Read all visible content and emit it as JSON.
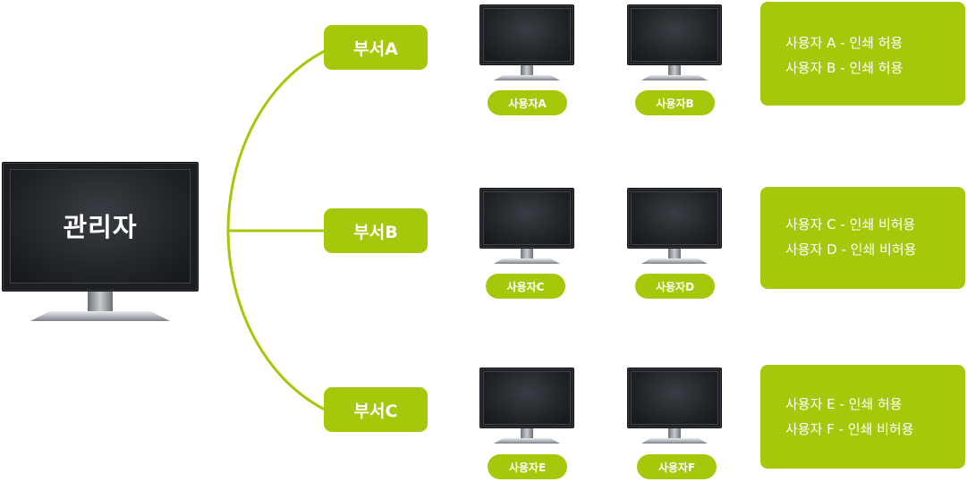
{
  "colors": {
    "accent": "#a6c80a",
    "line": "#a6c80a",
    "screen": "#23262a"
  },
  "admin": {
    "label": "관리자"
  },
  "departments": [
    {
      "label": "부서A"
    },
    {
      "label": "부서B"
    },
    {
      "label": "부서C"
    }
  ],
  "users": [
    {
      "label": "사용자A"
    },
    {
      "label": "사용자B"
    },
    {
      "label": "사용자C"
    },
    {
      "label": "사용자D"
    },
    {
      "label": "사용자E"
    },
    {
      "label": "사용자F"
    }
  ],
  "permissions": [
    {
      "lines": [
        "사용자 A - 인쇄 허용",
        "사용자 B - 인쇄 허용"
      ]
    },
    {
      "lines": [
        "사용자 C - 인쇄 비허용",
        "사용자 D - 인쇄 비허용"
      ]
    },
    {
      "lines": [
        "사용자 E - 인쇄 허용",
        "사용자 F - 인쇄 비허용"
      ]
    }
  ]
}
